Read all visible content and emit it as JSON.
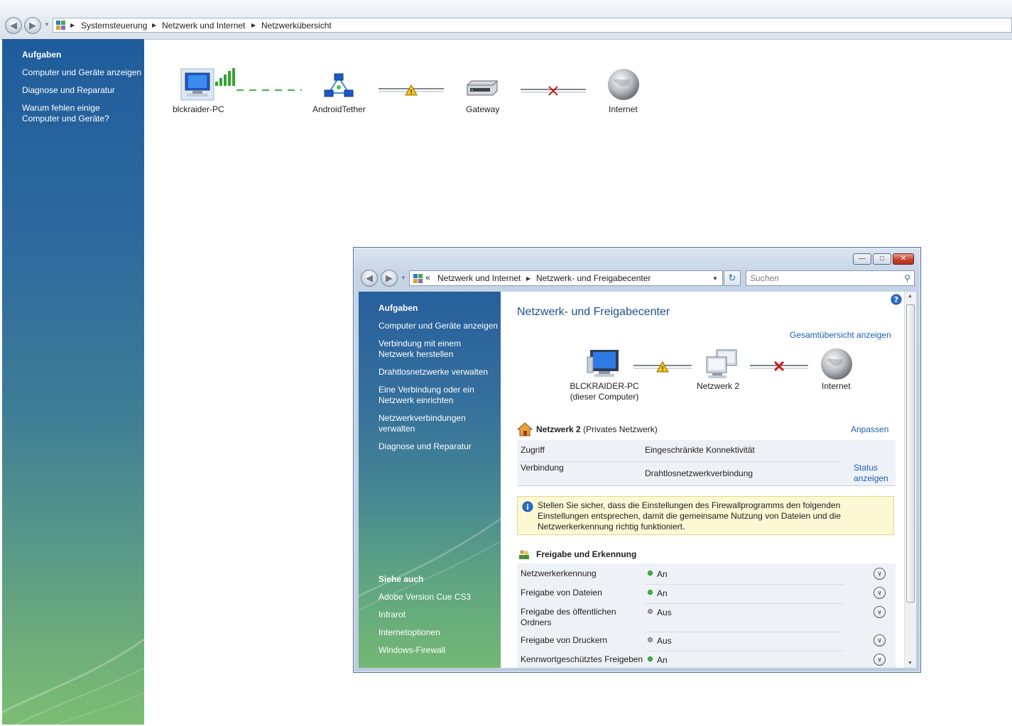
{
  "outer": {
    "breadcrumbs": [
      "Systemsteuerung",
      "Netzwerk und Internet",
      "Netzwerkübersicht"
    ],
    "sidebar": {
      "heading": "Aufgaben",
      "links": [
        "Computer und Geräte anzeigen",
        "Diagnose und Reparatur",
        "Warum fehlen einige Computer und Geräte?"
      ]
    },
    "map_nodes": [
      "blckraider-PC",
      "AndroidTether",
      "Gateway",
      "Internet"
    ]
  },
  "window": {
    "address": {
      "prefix": "«",
      "crumbs": [
        "Netzwerk und Internet",
        "Netzwerk- und Freigabecenter"
      ]
    },
    "search_placeholder": "Suchen",
    "sidebar": {
      "heading": "Aufgaben",
      "links": [
        "Computer und Geräte anzeigen",
        "Verbindung mit einem Netzwerk herstellen",
        "Drahtlosnetzwerke verwalten",
        "Eine Verbindung oder ein Netzwerk einrichten",
        "Netzwerkverbindungen verwalten",
        "Diagnose und Reparatur"
      ],
      "see_also_heading": "Siehe auch",
      "see_also": [
        "Adobe Version Cue CS3",
        "Infrarot",
        "Internetoptionen",
        "Windows-Firewall"
      ]
    },
    "main": {
      "title": "Netzwerk- und Freigabecenter",
      "full_map_link": "Gesamtübersicht anzeigen",
      "map": {
        "pc_name": "BLCKRAIDER-PC",
        "pc_sub": "(dieser Computer)",
        "network": "Netzwerk  2",
        "internet": "Internet"
      },
      "network_section": {
        "name": "Netzwerk  2",
        "type": "(Privates Netzwerk)",
        "customize": "Anpassen",
        "rows": [
          {
            "label": "Zugriff",
            "value": "Eingeschränkte Konnektivität"
          },
          {
            "label": "Verbindung",
            "value": "Drahtlosnetzwerkverbindung",
            "link": "Status anzeigen"
          }
        ]
      },
      "info_text": "Stellen Sie sicher, dass die Einstellungen des Firewallprogramms den folgenden Einstellungen entsprechen, damit die gemeinsame Nutzung von Dateien und die Netzwerkerkennung richtig funktioniert.",
      "sharing": {
        "heading": "Freigabe und Erkennung",
        "items": [
          {
            "label": "Netzwerkerkennung",
            "state": "An"
          },
          {
            "label": "Freigabe von Dateien",
            "state": "An"
          },
          {
            "label": "Freigabe des öffentlichen Ordners",
            "state": "Aus"
          },
          {
            "label": "Freigabe von Druckern",
            "state": "Aus"
          },
          {
            "label": "Kennwortgeschütztes Freigeben",
            "state": "An"
          }
        ]
      }
    }
  }
}
